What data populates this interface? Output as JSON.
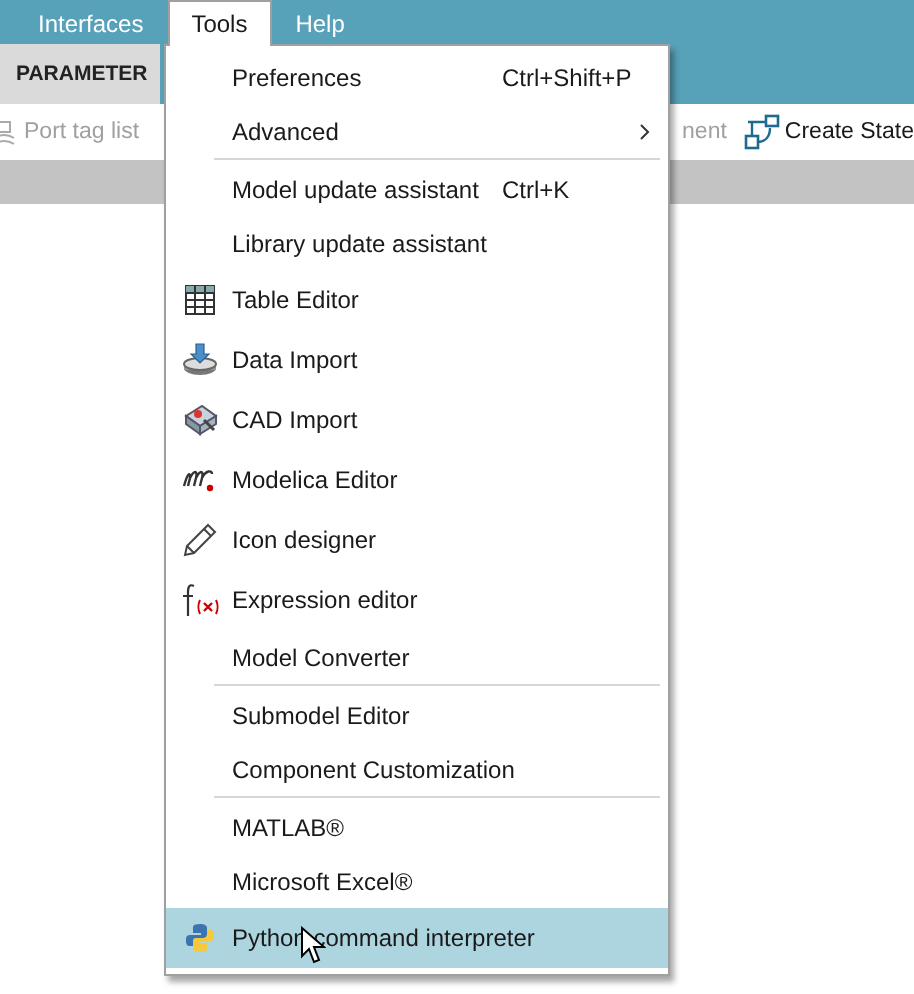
{
  "menubar": [
    {
      "label": "Interfaces",
      "selected": false
    },
    {
      "label": "Tools",
      "selected": true
    },
    {
      "label": "Help",
      "selected": false
    }
  ],
  "ribbon_tabs": [
    {
      "label": "PARAMETER",
      "selected": true
    }
  ],
  "toolbar": [
    {
      "label": "Port tag list",
      "disabled": true
    },
    {
      "label": "nent",
      "disabled": true
    },
    {
      "label": "Create State",
      "disabled": false
    }
  ],
  "menu": {
    "items": [
      {
        "kind": "item",
        "label": "Preferences",
        "shortcut": "Ctrl+Shift+P",
        "submenu": false,
        "selected": false
      },
      {
        "kind": "item",
        "label": "Advanced",
        "submenu": true,
        "selected": false
      },
      {
        "kind": "separator"
      },
      {
        "kind": "item",
        "label": "Model update assistant",
        "shortcut": "Ctrl+K",
        "submenu": false,
        "selected": false
      },
      {
        "kind": "item",
        "label": "Library update assistant",
        "submenu": false,
        "selected": false
      },
      {
        "kind": "item",
        "label": "Table Editor",
        "submenu": false,
        "selected": false
      },
      {
        "kind": "item",
        "label": "Data Import",
        "submenu": false,
        "selected": false
      },
      {
        "kind": "item",
        "label": "CAD Import",
        "submenu": false,
        "selected": false
      },
      {
        "kind": "item",
        "label": "Modelica Editor",
        "submenu": false,
        "selected": false
      },
      {
        "kind": "item",
        "label": "Icon designer",
        "submenu": false,
        "selected": false
      },
      {
        "kind": "item",
        "label": "Expression editor",
        "submenu": false,
        "selected": false
      },
      {
        "kind": "item",
        "label": "Model Converter",
        "submenu": false,
        "selected": false
      },
      {
        "kind": "separator"
      },
      {
        "kind": "item",
        "label": "Submodel Editor",
        "submenu": false,
        "selected": false
      },
      {
        "kind": "item",
        "label": "Component Customization",
        "submenu": false,
        "selected": false
      },
      {
        "kind": "separator"
      },
      {
        "kind": "item",
        "label": "MATLAB®",
        "submenu": false,
        "selected": false
      },
      {
        "kind": "item",
        "label": "Microsoft Excel®",
        "submenu": false,
        "selected": false
      },
      {
        "kind": "item",
        "label": "Python command interpreter",
        "submenu": false,
        "selected": true
      }
    ]
  }
}
